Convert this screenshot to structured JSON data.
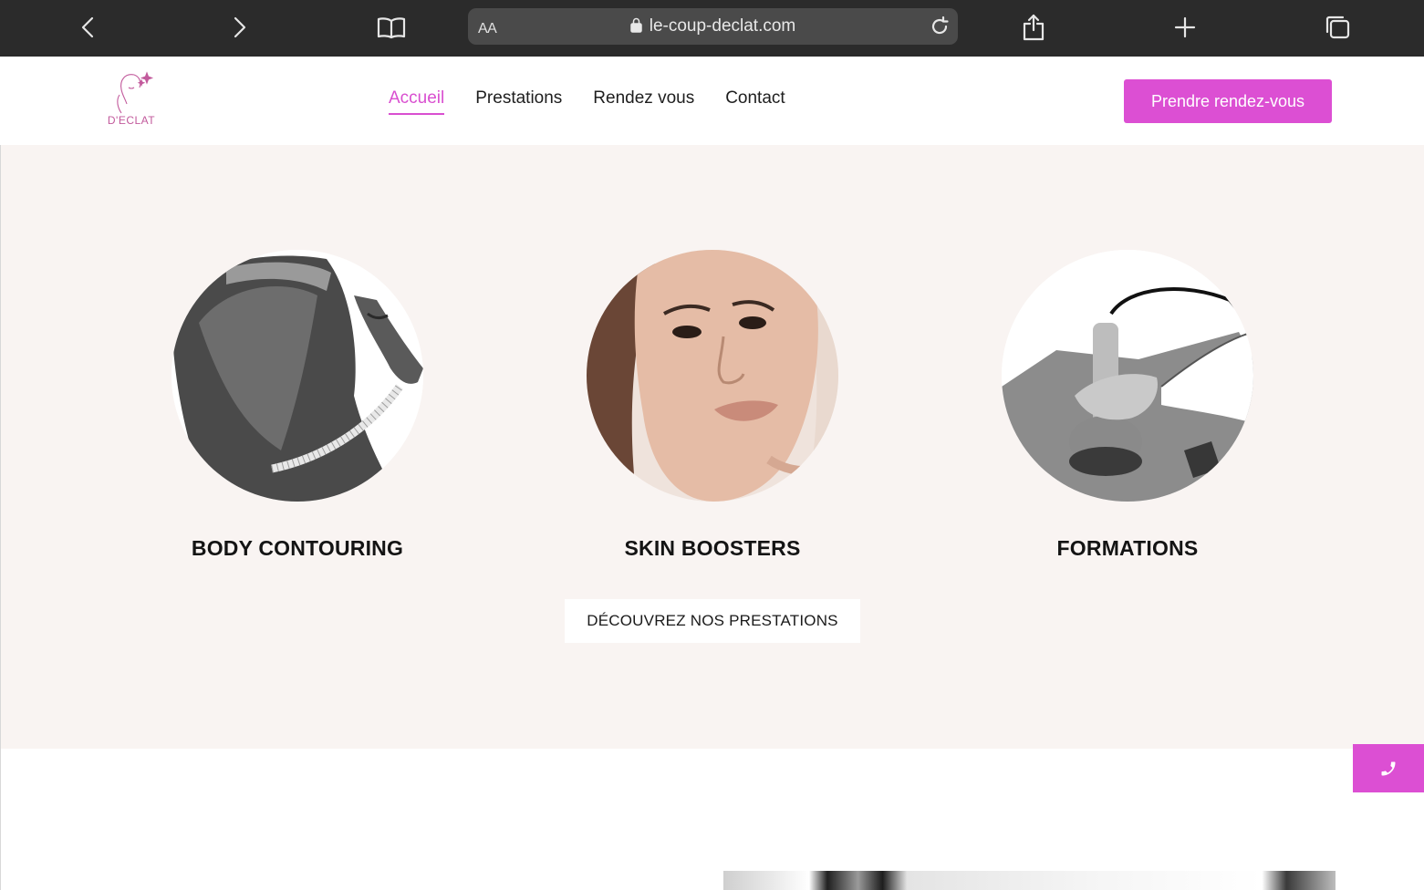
{
  "browser": {
    "url": "le-coup-declat.com",
    "reader_label": "AA"
  },
  "header": {
    "logo_text": "D'ECLAT",
    "nav": [
      {
        "label": "Accueil",
        "active": true
      },
      {
        "label": "Prestations",
        "active": false
      },
      {
        "label": "Rendez vous",
        "active": false
      },
      {
        "label": "Contact",
        "active": false
      }
    ],
    "cta_label": "Prendre rendez-vous"
  },
  "services": [
    {
      "title": "BODY CONTOURING",
      "image": "body-contouring-photo"
    },
    {
      "title": "SKIN BOOSTERS",
      "image": "woman-face-photo"
    },
    {
      "title": "FORMATIONS",
      "image": "device-treatment-photo"
    }
  ],
  "discover_label": "DÉCOUVREZ NOS PRESTATIONS",
  "colors": {
    "accent": "#dc4fd3",
    "section_bg": "#f9f4f2",
    "chrome_bg": "#2b2b2b"
  },
  "icons": {
    "back": "chevron-left-icon",
    "forward": "chevron-right-icon",
    "bookmarks": "book-icon",
    "lock": "lock-icon",
    "reload": "reload-icon",
    "share": "share-icon",
    "new_tab": "plus-icon",
    "tabs": "tabs-icon",
    "phone": "phone-icon"
  }
}
